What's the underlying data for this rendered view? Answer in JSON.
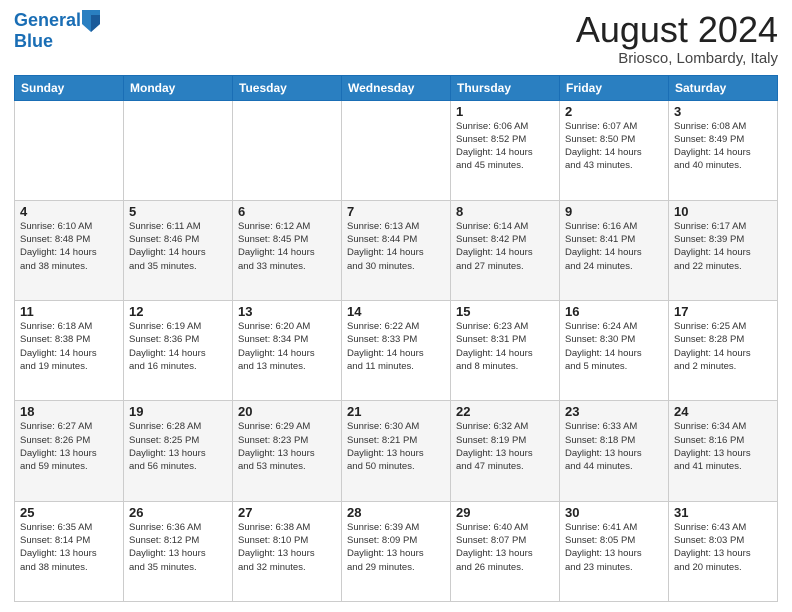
{
  "header": {
    "logo_line1": "General",
    "logo_line2": "Blue",
    "title": "August 2024",
    "subtitle": "Briosco, Lombardy, Italy"
  },
  "weekdays": [
    "Sunday",
    "Monday",
    "Tuesday",
    "Wednesday",
    "Thursday",
    "Friday",
    "Saturday"
  ],
  "weeks": [
    [
      {
        "day": "",
        "info": ""
      },
      {
        "day": "",
        "info": ""
      },
      {
        "day": "",
        "info": ""
      },
      {
        "day": "",
        "info": ""
      },
      {
        "day": "1",
        "info": "Sunrise: 6:06 AM\nSunset: 8:52 PM\nDaylight: 14 hours\nand 45 minutes."
      },
      {
        "day": "2",
        "info": "Sunrise: 6:07 AM\nSunset: 8:50 PM\nDaylight: 14 hours\nand 43 minutes."
      },
      {
        "day": "3",
        "info": "Sunrise: 6:08 AM\nSunset: 8:49 PM\nDaylight: 14 hours\nand 40 minutes."
      }
    ],
    [
      {
        "day": "4",
        "info": "Sunrise: 6:10 AM\nSunset: 8:48 PM\nDaylight: 14 hours\nand 38 minutes."
      },
      {
        "day": "5",
        "info": "Sunrise: 6:11 AM\nSunset: 8:46 PM\nDaylight: 14 hours\nand 35 minutes."
      },
      {
        "day": "6",
        "info": "Sunrise: 6:12 AM\nSunset: 8:45 PM\nDaylight: 14 hours\nand 33 minutes."
      },
      {
        "day": "7",
        "info": "Sunrise: 6:13 AM\nSunset: 8:44 PM\nDaylight: 14 hours\nand 30 minutes."
      },
      {
        "day": "8",
        "info": "Sunrise: 6:14 AM\nSunset: 8:42 PM\nDaylight: 14 hours\nand 27 minutes."
      },
      {
        "day": "9",
        "info": "Sunrise: 6:16 AM\nSunset: 8:41 PM\nDaylight: 14 hours\nand 24 minutes."
      },
      {
        "day": "10",
        "info": "Sunrise: 6:17 AM\nSunset: 8:39 PM\nDaylight: 14 hours\nand 22 minutes."
      }
    ],
    [
      {
        "day": "11",
        "info": "Sunrise: 6:18 AM\nSunset: 8:38 PM\nDaylight: 14 hours\nand 19 minutes."
      },
      {
        "day": "12",
        "info": "Sunrise: 6:19 AM\nSunset: 8:36 PM\nDaylight: 14 hours\nand 16 minutes."
      },
      {
        "day": "13",
        "info": "Sunrise: 6:20 AM\nSunset: 8:34 PM\nDaylight: 14 hours\nand 13 minutes."
      },
      {
        "day": "14",
        "info": "Sunrise: 6:22 AM\nSunset: 8:33 PM\nDaylight: 14 hours\nand 11 minutes."
      },
      {
        "day": "15",
        "info": "Sunrise: 6:23 AM\nSunset: 8:31 PM\nDaylight: 14 hours\nand 8 minutes."
      },
      {
        "day": "16",
        "info": "Sunrise: 6:24 AM\nSunset: 8:30 PM\nDaylight: 14 hours\nand 5 minutes."
      },
      {
        "day": "17",
        "info": "Sunrise: 6:25 AM\nSunset: 8:28 PM\nDaylight: 14 hours\nand 2 minutes."
      }
    ],
    [
      {
        "day": "18",
        "info": "Sunrise: 6:27 AM\nSunset: 8:26 PM\nDaylight: 13 hours\nand 59 minutes."
      },
      {
        "day": "19",
        "info": "Sunrise: 6:28 AM\nSunset: 8:25 PM\nDaylight: 13 hours\nand 56 minutes."
      },
      {
        "day": "20",
        "info": "Sunrise: 6:29 AM\nSunset: 8:23 PM\nDaylight: 13 hours\nand 53 minutes."
      },
      {
        "day": "21",
        "info": "Sunrise: 6:30 AM\nSunset: 8:21 PM\nDaylight: 13 hours\nand 50 minutes."
      },
      {
        "day": "22",
        "info": "Sunrise: 6:32 AM\nSunset: 8:19 PM\nDaylight: 13 hours\nand 47 minutes."
      },
      {
        "day": "23",
        "info": "Sunrise: 6:33 AM\nSunset: 8:18 PM\nDaylight: 13 hours\nand 44 minutes."
      },
      {
        "day": "24",
        "info": "Sunrise: 6:34 AM\nSunset: 8:16 PM\nDaylight: 13 hours\nand 41 minutes."
      }
    ],
    [
      {
        "day": "25",
        "info": "Sunrise: 6:35 AM\nSunset: 8:14 PM\nDaylight: 13 hours\nand 38 minutes."
      },
      {
        "day": "26",
        "info": "Sunrise: 6:36 AM\nSunset: 8:12 PM\nDaylight: 13 hours\nand 35 minutes."
      },
      {
        "day": "27",
        "info": "Sunrise: 6:38 AM\nSunset: 8:10 PM\nDaylight: 13 hours\nand 32 minutes."
      },
      {
        "day": "28",
        "info": "Sunrise: 6:39 AM\nSunset: 8:09 PM\nDaylight: 13 hours\nand 29 minutes."
      },
      {
        "day": "29",
        "info": "Sunrise: 6:40 AM\nSunset: 8:07 PM\nDaylight: 13 hours\nand 26 minutes."
      },
      {
        "day": "30",
        "info": "Sunrise: 6:41 AM\nSunset: 8:05 PM\nDaylight: 13 hours\nand 23 minutes."
      },
      {
        "day": "31",
        "info": "Sunrise: 6:43 AM\nSunset: 8:03 PM\nDaylight: 13 hours\nand 20 minutes."
      }
    ]
  ]
}
